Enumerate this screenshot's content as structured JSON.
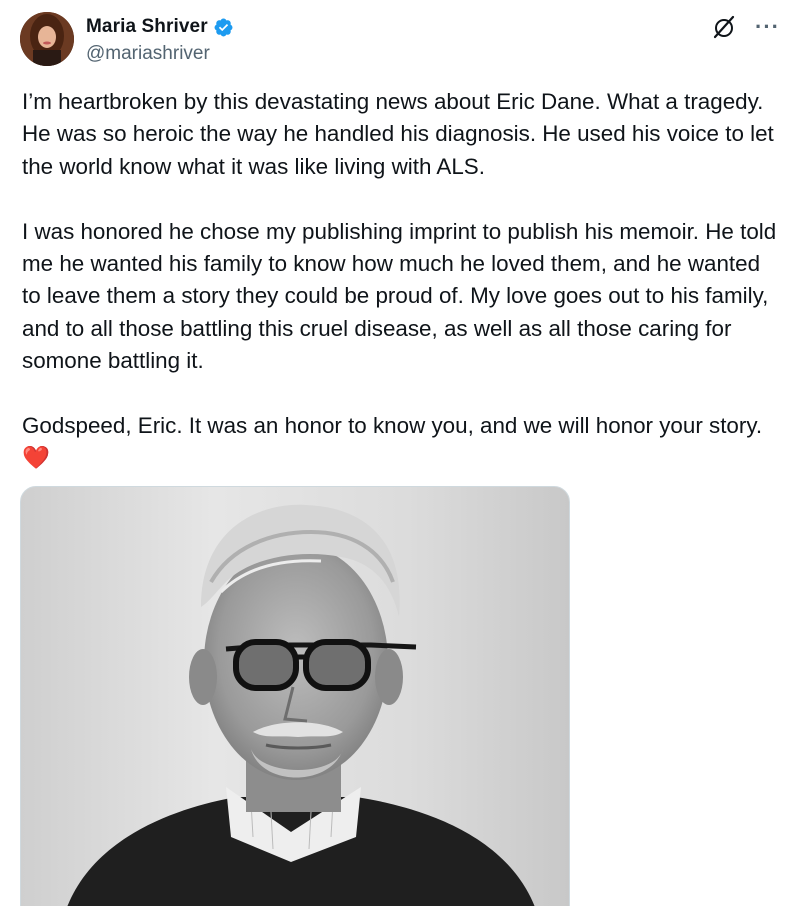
{
  "author": {
    "display_name": "Maria Shriver",
    "handle": "@mariashriver",
    "verified": true,
    "avatar_icon": "profile-photo"
  },
  "header_icons": {
    "grok": "grok-icon",
    "more": "···"
  },
  "post": {
    "paragraph_1": "I’m heartbroken by this devastating news about Eric Dane. What a tragedy. He was so heroic the way he handled his diagnosis. He used his voice to let the world know what it was like living with ALS.",
    "paragraph_2": "I was honored he chose my publishing imprint to publish his memoir. He told me he wanted his family to know how much he loved them, and he wanted to leave them a story they could be proud of. My love goes out to his family, and to all those battling this cruel disease, as well as all those caring for somone battling it.",
    "paragraph_3": "Godspeed, Eric. It was an honor to know you, and we will honor your story.",
    "emoji": "❤️"
  },
  "media": {
    "type": "photo",
    "description_icon": "black-and-white-portrait"
  },
  "colors": {
    "text": "#0f1419",
    "secondary": "#536471",
    "verified": "#1d9bf0",
    "heart": "#e0245e"
  }
}
